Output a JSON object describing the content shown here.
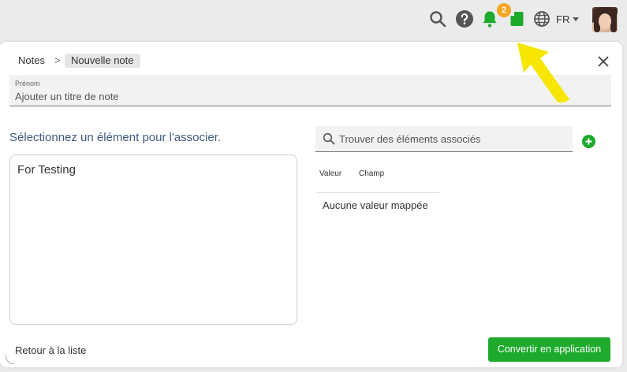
{
  "header": {
    "notification_count": "2",
    "language": "FR",
    "icons": [
      "search-icon",
      "help-icon",
      "bell-icon",
      "note-icon",
      "globe-icon",
      "chevron-down-icon"
    ],
    "accent_color": "#1eab2d",
    "badge_color": "#f5a623"
  },
  "breadcrumb": {
    "root": "Notes",
    "separator": ">",
    "current": "Nouvelle note"
  },
  "title_field": {
    "label": "Prénom",
    "value": "Ajouter un titre de note"
  },
  "left_panel": {
    "heading": "Sélectionnez un élément pour l'associer.",
    "content": "For Testing"
  },
  "right_panel": {
    "search_placeholder": "Trouver des éléments associés",
    "columns": [
      "Valeur",
      "Champ"
    ],
    "empty_message": "Aucune valeur mappée"
  },
  "footer": {
    "back_label": "Retour à la liste",
    "convert_label": "Convertir en application"
  },
  "annotation": {
    "arrow_color": "#f7e600"
  }
}
